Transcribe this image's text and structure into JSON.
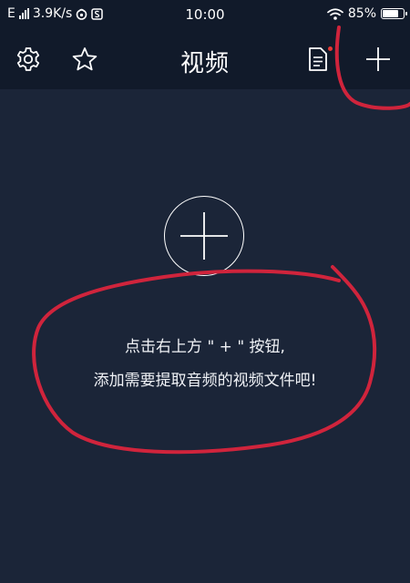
{
  "status_bar": {
    "network_type": "E",
    "speed": "3.9K/s",
    "time": "10:00",
    "battery_percent": "85%",
    "battery_level": 0.85
  },
  "header": {
    "title": "视频",
    "icons": [
      "gear-icon",
      "star-icon",
      "document-icon",
      "plus-icon"
    ]
  },
  "empty_state": {
    "line1": "点击右上方 \" + \" 按钮,",
    "line2": "添加需要提取音频的视频文件吧!"
  },
  "colors": {
    "background": "#1b2538",
    "bar": "#111a2a",
    "annotation_red": "#d0243c",
    "badge_red": "#e53935"
  }
}
